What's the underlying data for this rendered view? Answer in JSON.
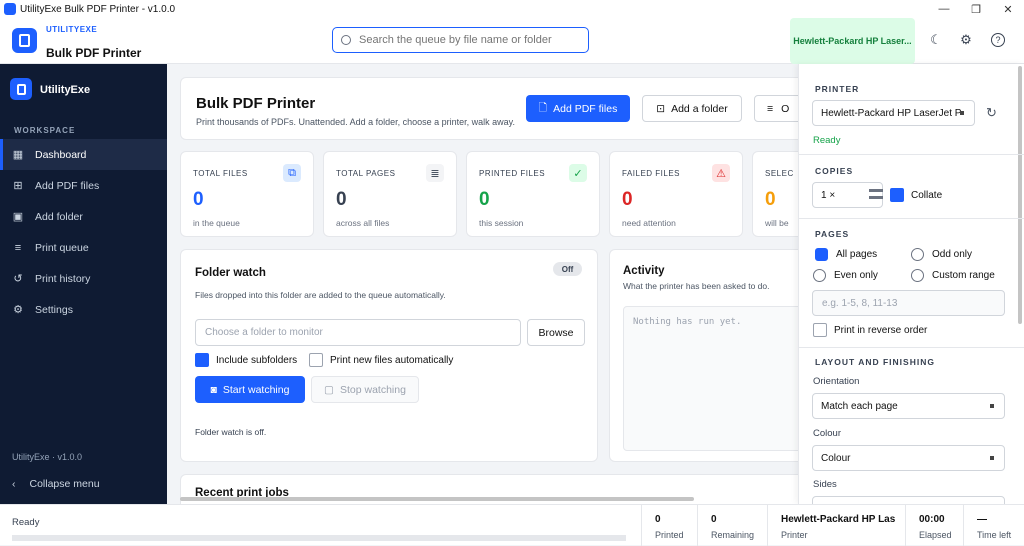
{
  "window": {
    "title": "UtilityExe Bulk PDF Printer  -  v1.0.0",
    "min": "—",
    "max": "❐",
    "close": "✕"
  },
  "header": {
    "brand_small": "UTILITYEXE",
    "brand_big": "Bulk PDF Printer",
    "search_placeholder": "Search the queue by file name or folder",
    "printer_chip": "Hewlett-Packard HP Laser..."
  },
  "sidebar": {
    "brand": "UtilityExe",
    "section": "WORKSPACE",
    "items": [
      {
        "label": "Dashboard",
        "icon": "dashboard-icon",
        "glyph": "▦",
        "active": true
      },
      {
        "label": "Add PDF files",
        "icon": "add-file-icon",
        "glyph": "⊞"
      },
      {
        "label": "Add folder",
        "icon": "add-folder-icon",
        "glyph": "▣"
      },
      {
        "label": "Print queue",
        "icon": "queue-icon",
        "glyph": "≡"
      },
      {
        "label": "Print history",
        "icon": "history-icon",
        "glyph": "↺"
      },
      {
        "label": "Settings",
        "icon": "settings-icon",
        "glyph": "⚙"
      }
    ],
    "version": "UtilityExe · v1.0.0",
    "collapse": "Collapse menu"
  },
  "hero": {
    "title": "Bulk PDF Printer",
    "subtitle": "Print thousands of PDFs. Unattended.  Add a folder, choose a printer, walk away.",
    "add_pdf": "Add PDF files",
    "add_folder": "Add a folder",
    "third": "O"
  },
  "stats": [
    {
      "label": "TOTAL FILES",
      "value": "0",
      "sub": "in the queue",
      "color": "#1d5ffe",
      "icon_bg": "#dbeafe",
      "icon": "⧉"
    },
    {
      "label": "TOTAL PAGES",
      "value": "0",
      "sub": "across all files",
      "color": "#374151",
      "icon_bg": "#f3f4f6",
      "icon": "≣"
    },
    {
      "label": "PRINTED FILES",
      "value": "0",
      "sub": "this session",
      "color": "#16a34a",
      "icon_bg": "#dcfce7",
      "icon": "✓"
    },
    {
      "label": "FAILED FILES",
      "value": "0",
      "sub": "need attention",
      "color": "#dc2626",
      "icon_bg": "#fee2e2",
      "icon": "⚠"
    },
    {
      "label": "SELEC",
      "value": "0",
      "sub": "will be",
      "color": "#f59e0b"
    }
  ],
  "folder_watch": {
    "title": "Folder watch",
    "toggle": "Off",
    "subtitle": "Files dropped into this folder are added to the queue automatically.",
    "placeholder": "Choose a folder to monitor",
    "browse": "Browse",
    "include_subfolders": "Include subfolders",
    "print_auto": "Print new files automatically",
    "start": "Start watching",
    "stop": "Stop watching",
    "status": "Folder watch is off."
  },
  "activity": {
    "title": "Activity",
    "subtitle": "What the printer has been asked to do.",
    "empty": "Nothing has run yet."
  },
  "recent": {
    "title": "Recent print jobs"
  },
  "panel": {
    "printer_head": "PRINTER",
    "printer_value": "Hewlett-Packard HP LaserJet P",
    "printer_status": "Ready",
    "copies_head": "COPIES",
    "copies_value": "1 ×",
    "collate": "Collate",
    "pages_head": "PAGES",
    "all_pages": "All pages",
    "odd_only": "Odd only",
    "even_only": "Even only",
    "custom_range": "Custom range",
    "range_placeholder": "e.g. 1-5, 8, 11-13",
    "reverse": "Print in reverse order",
    "layout_head": "LAYOUT AND FINISHING",
    "orientation_label": "Orientation",
    "orientation_value": "Match each page",
    "colour_label": "Colour",
    "colour_value": "Colour",
    "sides_label": "Sides"
  },
  "status": {
    "ready": "Ready",
    "printed_value": "0",
    "printed_label": "Printed",
    "remaining_value": "0",
    "remaining_label": "Remaining",
    "printer_value": "Hewlett-Packard HP Las",
    "printer_label": "Printer",
    "elapsed_value": "00:00",
    "elapsed_label": "Elapsed",
    "timeleft_value": "—",
    "timeleft_label": "Time left",
    "progress": 0
  },
  "colors": {
    "accent": "#1d5ffe",
    "sidebar": "#0f1b33",
    "success": "#16a34a",
    "danger": "#dc2626",
    "warning": "#f59e0b"
  }
}
